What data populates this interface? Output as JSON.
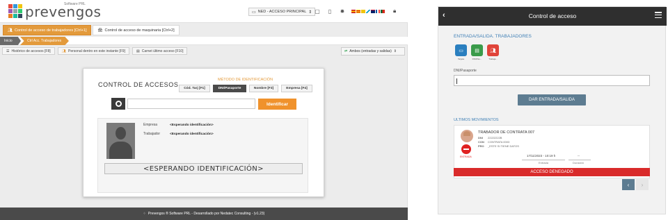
{
  "desktop": {
    "brand": "prevengos",
    "brand_sub": "Software PRL",
    "logo_colors": [
      "#e74c3c",
      "#3498db",
      "#f1c40f",
      "#9b59b6",
      "#95a5a6",
      "#2ecc71",
      "#e67e22",
      "#1abc9c",
      "#34495e"
    ],
    "env_selector": "NED - ACCESO PRINCIPAL",
    "tabs": [
      {
        "label": "Control de acceso de trabajadores [Ctrl+1]",
        "active": true
      },
      {
        "label": "Control de acceso de maquinaria [Ctrl+2]",
        "active": false
      }
    ],
    "breadcrumb": [
      "Inicio",
      "Ctrl Acc. Trabajadores"
    ],
    "actions": [
      {
        "label": "Histórico de accesos [F8]"
      },
      {
        "label": "Personal dentro en este instante [F9]"
      },
      {
        "label": "Carnet último acceso [F10]"
      }
    ],
    "filter": "Ambos (entradas y salidas)",
    "card": {
      "title": "CONTROL DE ACCESOS",
      "method_title": "MÉTODO DE IDENTIFICACIÓN",
      "methods": [
        {
          "label": "Cód. Tarj [F1]",
          "active": false
        },
        {
          "label": "DNI/Pasaporte",
          "active": true
        },
        {
          "label": "Nombre [F3]",
          "active": false
        },
        {
          "label": "Empresa [F4]",
          "active": false
        }
      ],
      "identify_button": "Identificar",
      "empresa_label": "Empresa",
      "empresa_value": "<Esperando identificación>",
      "trabajador_label": "Trabajador",
      "trabajador_value": "<Esperando identificación>",
      "status": "<ESPERANDO IDENTIFICACIÓN>"
    },
    "footer": "Prevengos ® Software PRL - Desarrollado por Nedatec Consulting - (v1.23)"
  },
  "mobile": {
    "title": "Control de acceso",
    "section1": "ENTRADA/SALIDA. TRABAJADORES",
    "quick_buttons": [
      {
        "label": "Tarjeta",
        "icon": "card-icon",
        "color": "#2a7fbf"
      },
      {
        "label": "DNI/Pas...",
        "icon": "id-card-icon",
        "color": "#3a9b4a"
      },
      {
        "label": "Trabaja...",
        "icon": "workers-icon",
        "color": "#e0443a"
      }
    ],
    "dni_label": "DNI/Pasaporte",
    "dar_button": "DAR ENTRADA/SALIDA",
    "section2": "ULTIMOS MOVIMIENTOS",
    "movement": {
      "name": "TRABADOR DE CONTRATA 007",
      "dni_key": "DNI",
      "dni": "22222222B",
      "con_key": "CON",
      "con": "CONTRATA 0003",
      "pro_key": "PRO",
      "pro": "_ESTE SI TIENE DATOS",
      "type": "ENTRADA",
      "date": "17/11/2023 - 10:19 h",
      "date_caption": "Entrada",
      "duration": "--",
      "duration_caption": "Duración",
      "result": "ACCESO DENEGADO"
    },
    "prev": "‹",
    "next": "›"
  }
}
